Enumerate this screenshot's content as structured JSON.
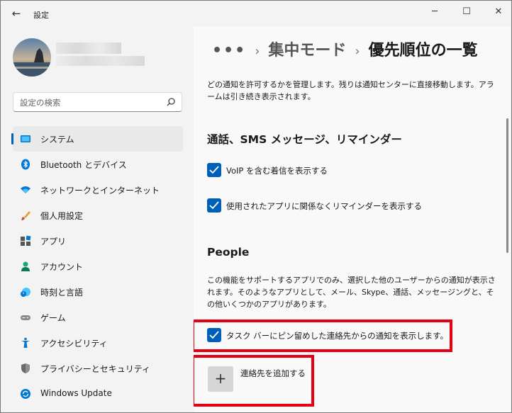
{
  "app": {
    "title": "設定",
    "back": "←",
    "minimize": "─",
    "maximize": "☐",
    "close": "✕"
  },
  "search": {
    "placeholder": "設定の検索",
    "icon": "search-icon"
  },
  "nav": [
    {
      "label": "システム",
      "icon": "system-icon",
      "active": true
    },
    {
      "label": "Bluetooth とデバイス",
      "icon": "bluetooth-icon"
    },
    {
      "label": "ネットワークとインターネット",
      "icon": "wifi-icon"
    },
    {
      "label": "個人用設定",
      "icon": "brush-icon"
    },
    {
      "label": "アプリ",
      "icon": "apps-icon"
    },
    {
      "label": "アカウント",
      "icon": "account-icon"
    },
    {
      "label": "時刻と言語",
      "icon": "clock-globe-icon"
    },
    {
      "label": "ゲーム",
      "icon": "gamepad-icon"
    },
    {
      "label": "アクセシビリティ",
      "icon": "accessibility-icon"
    },
    {
      "label": "プライバシーとセキュリティ",
      "icon": "shield-icon"
    },
    {
      "label": "Windows Update",
      "icon": "update-icon"
    }
  ],
  "breadcrumb": {
    "dots": "•••",
    "sep": "›",
    "parent": "集中モード",
    "current": "優先順位の一覧"
  },
  "intro": "どの通知を許可するかを管理します。残りは通知センターに直接移動します。アラームは引き続き表示されます。",
  "calls_section": {
    "title": "通話、SMS メッセージ、リマインダー",
    "options": [
      {
        "label": "VoIP を含む着信を表示する",
        "checked": true
      },
      {
        "label": "使用されたアプリに関係なくリマインダーを表示する",
        "checked": true
      }
    ]
  },
  "people_section": {
    "title": "People",
    "description": "この機能をサポートするアプリでのみ、選択した他のユーザーからの通知が表示されます。そのようなアプリとして、メール、Skype、通話、メッセージングと、その他いくつかのアプリがあります。",
    "option": {
      "label": "タスク バーにピン留めした連絡先からの通知を表示します。",
      "checked": true
    },
    "add_button": "+",
    "add_label": "連絡先を追加する"
  },
  "colors": {
    "accent": "#005fb8",
    "highlight": "#e60012"
  }
}
